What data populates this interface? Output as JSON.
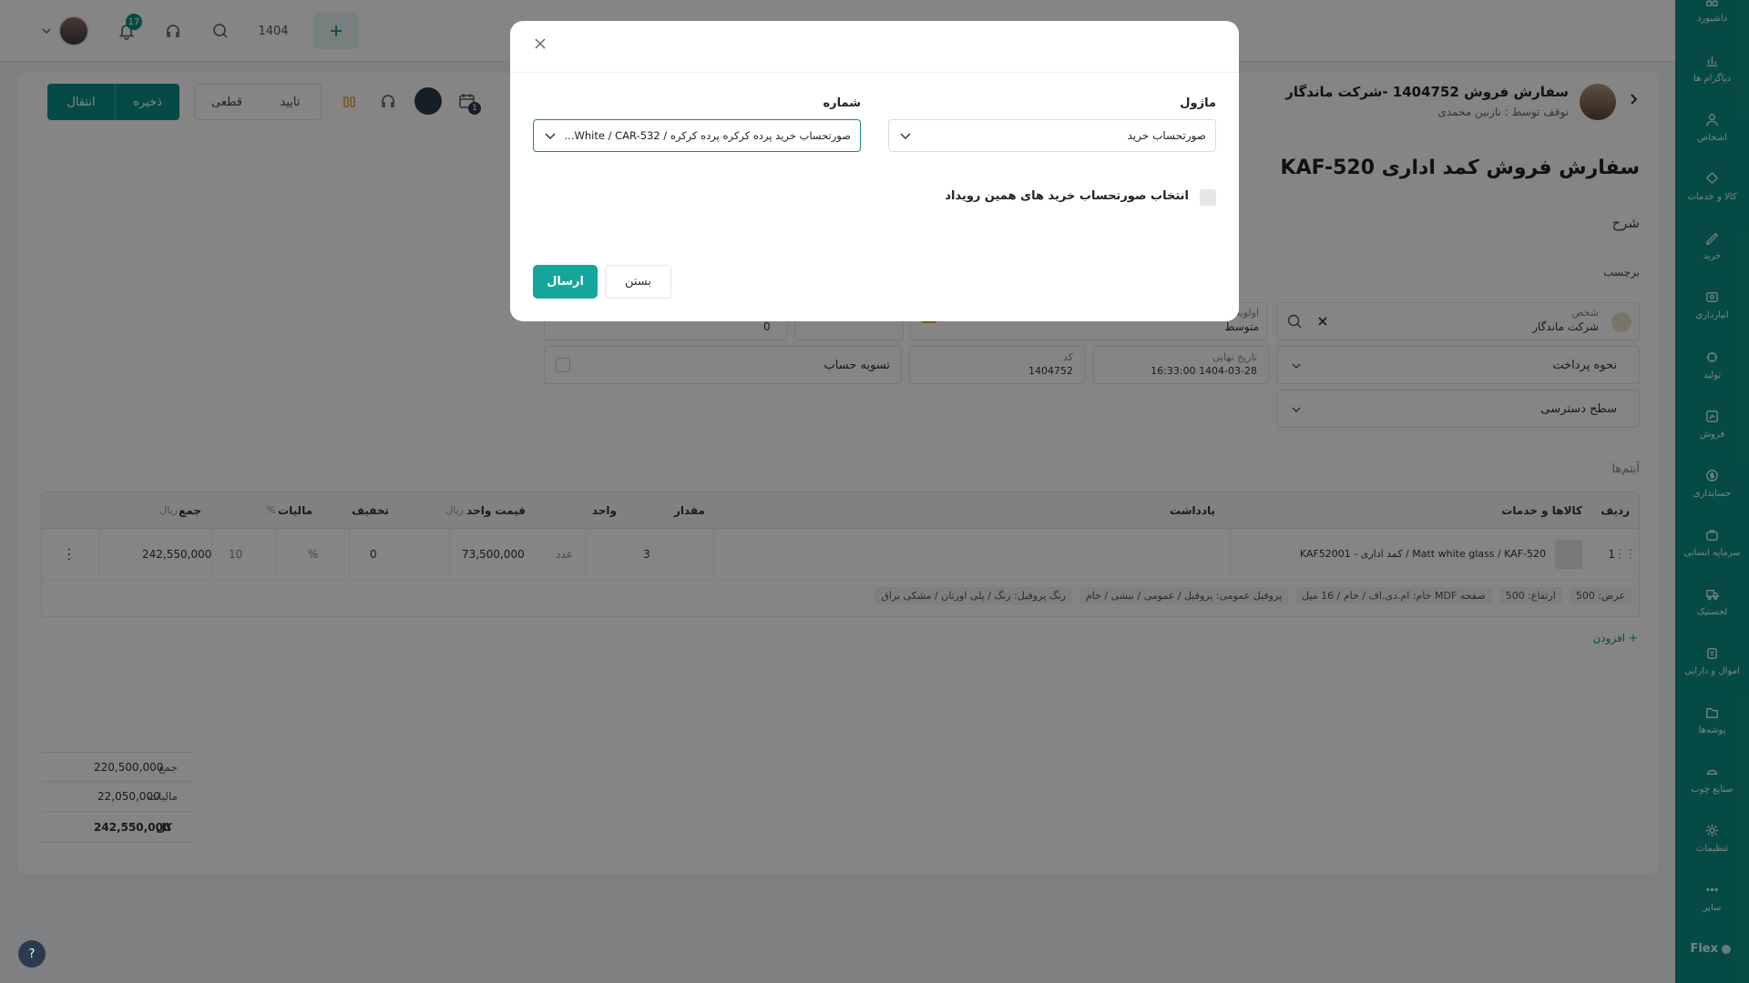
{
  "topbar": {
    "notifications_count": "17",
    "search_number": "1404"
  },
  "toolbar": {
    "transfer_label": "انتقال",
    "save_label": "ذخیره",
    "final_label": "قطعی",
    "approve_label": "تایید",
    "badge_count": "1"
  },
  "header": {
    "title": "سفارش فروش 1404752 -شرکت ماندگار",
    "subtitle": "توقف توسط : نازنین محمدی"
  },
  "page": {
    "title": "سفارش فروش کمد اداری KAF-520",
    "description_label": "شرح",
    "tag_label": "برچسب",
    "items_label": "آیتم‌ها"
  },
  "form": {
    "person_label": "شخص",
    "person_value": "شرکت ماندگار",
    "priority_label": "اولویت",
    "priority_value": "متوسط",
    "amount_value": "0",
    "payment_label": "نحوه پرداخت",
    "final_date_label": "تاریخ نهایی",
    "final_date_value": "1404-03-28 16:33:00",
    "code_label": "کد",
    "code_value": "1404752",
    "settlement_label": "تسویه حساب",
    "access_label": "سطح دسترسی"
  },
  "table": {
    "headers": {
      "row": "ردیف",
      "goods": "کالاها و خدمات",
      "note": "یادداشت",
      "qty": "مقدار",
      "unit": "واحد",
      "unit_price": "قیمت واحد",
      "unit_price_cur": "ریال",
      "discount": "تخفیف",
      "tax": "مالیات",
      "tax_pct": "%",
      "total": "جمع",
      "total_cur": "ریال"
    },
    "rows": [
      {
        "index": "1",
        "goods": "KAF52001 - کمد اداری / Matt white glass / KAF-520",
        "qty": "3",
        "unit": "عدد",
        "unit_price": "73,500,000",
        "discount": "0",
        "discount_pct": "%",
        "tax": "10",
        "total": "242,550,000"
      }
    ],
    "attributes": [
      "عرض: 500",
      "ارتفاع: 500",
      "صفحه MDF خام: ام.دی.اف / خام / 16 میل",
      "پروفیل عمومی: پروفیل / عمومی / نبشی / خام",
      "رنگ پروفیل: رنگ / پلی اورتان / مشکی براق"
    ],
    "add_label": "+ افزودن"
  },
  "totals": {
    "sum_label": "جمع",
    "sum_value": "220,500,000",
    "tax_label": "مالیات",
    "tax_value": "22,050,000",
    "total_label": "کل",
    "total_value": "242,550,000"
  },
  "sidebar": {
    "items": [
      {
        "label": "داشبورد",
        "icon": "dashboard-icon"
      },
      {
        "label": "دیاگرام ها",
        "icon": "chart-icon"
      },
      {
        "label": "اشخاص",
        "icon": "people-icon"
      },
      {
        "label": "کالا و خدمات",
        "icon": "box-icon"
      },
      {
        "label": "خرید",
        "icon": "cart-icon"
      },
      {
        "label": "انبارداری",
        "icon": "warehouse-icon"
      },
      {
        "label": "تولید",
        "icon": "production-icon"
      },
      {
        "label": "فروش",
        "icon": "sales-icon"
      },
      {
        "label": "حسابداری",
        "icon": "dollar-icon"
      },
      {
        "label": "سرمایه انسانی",
        "icon": "hr-icon"
      },
      {
        "label": "لجستیک",
        "icon": "truck-icon"
      },
      {
        "label": "اموال و دارایی",
        "icon": "asset-icon"
      },
      {
        "label": "پوشه‌ها",
        "icon": "folder-icon"
      },
      {
        "label": "صنایع چوب",
        "icon": "wood-icon"
      },
      {
        "label": "تنظیمات",
        "icon": "gear-icon"
      },
      {
        "label": "سایر",
        "icon": "more-icon"
      }
    ],
    "brand": "Flex"
  },
  "modal": {
    "module_label": "ماژول",
    "module_value": "صورتحساب خرید",
    "number_label": "شماره",
    "number_value": "صورتحساب خرید پرده کرکره پرده کرکره / White / CAR-532...",
    "checkbox_label": "انتخاب صورتحساب خرید های همین رویداد",
    "close_label": "بستن",
    "submit_label": "ارسال"
  },
  "help": "?"
}
